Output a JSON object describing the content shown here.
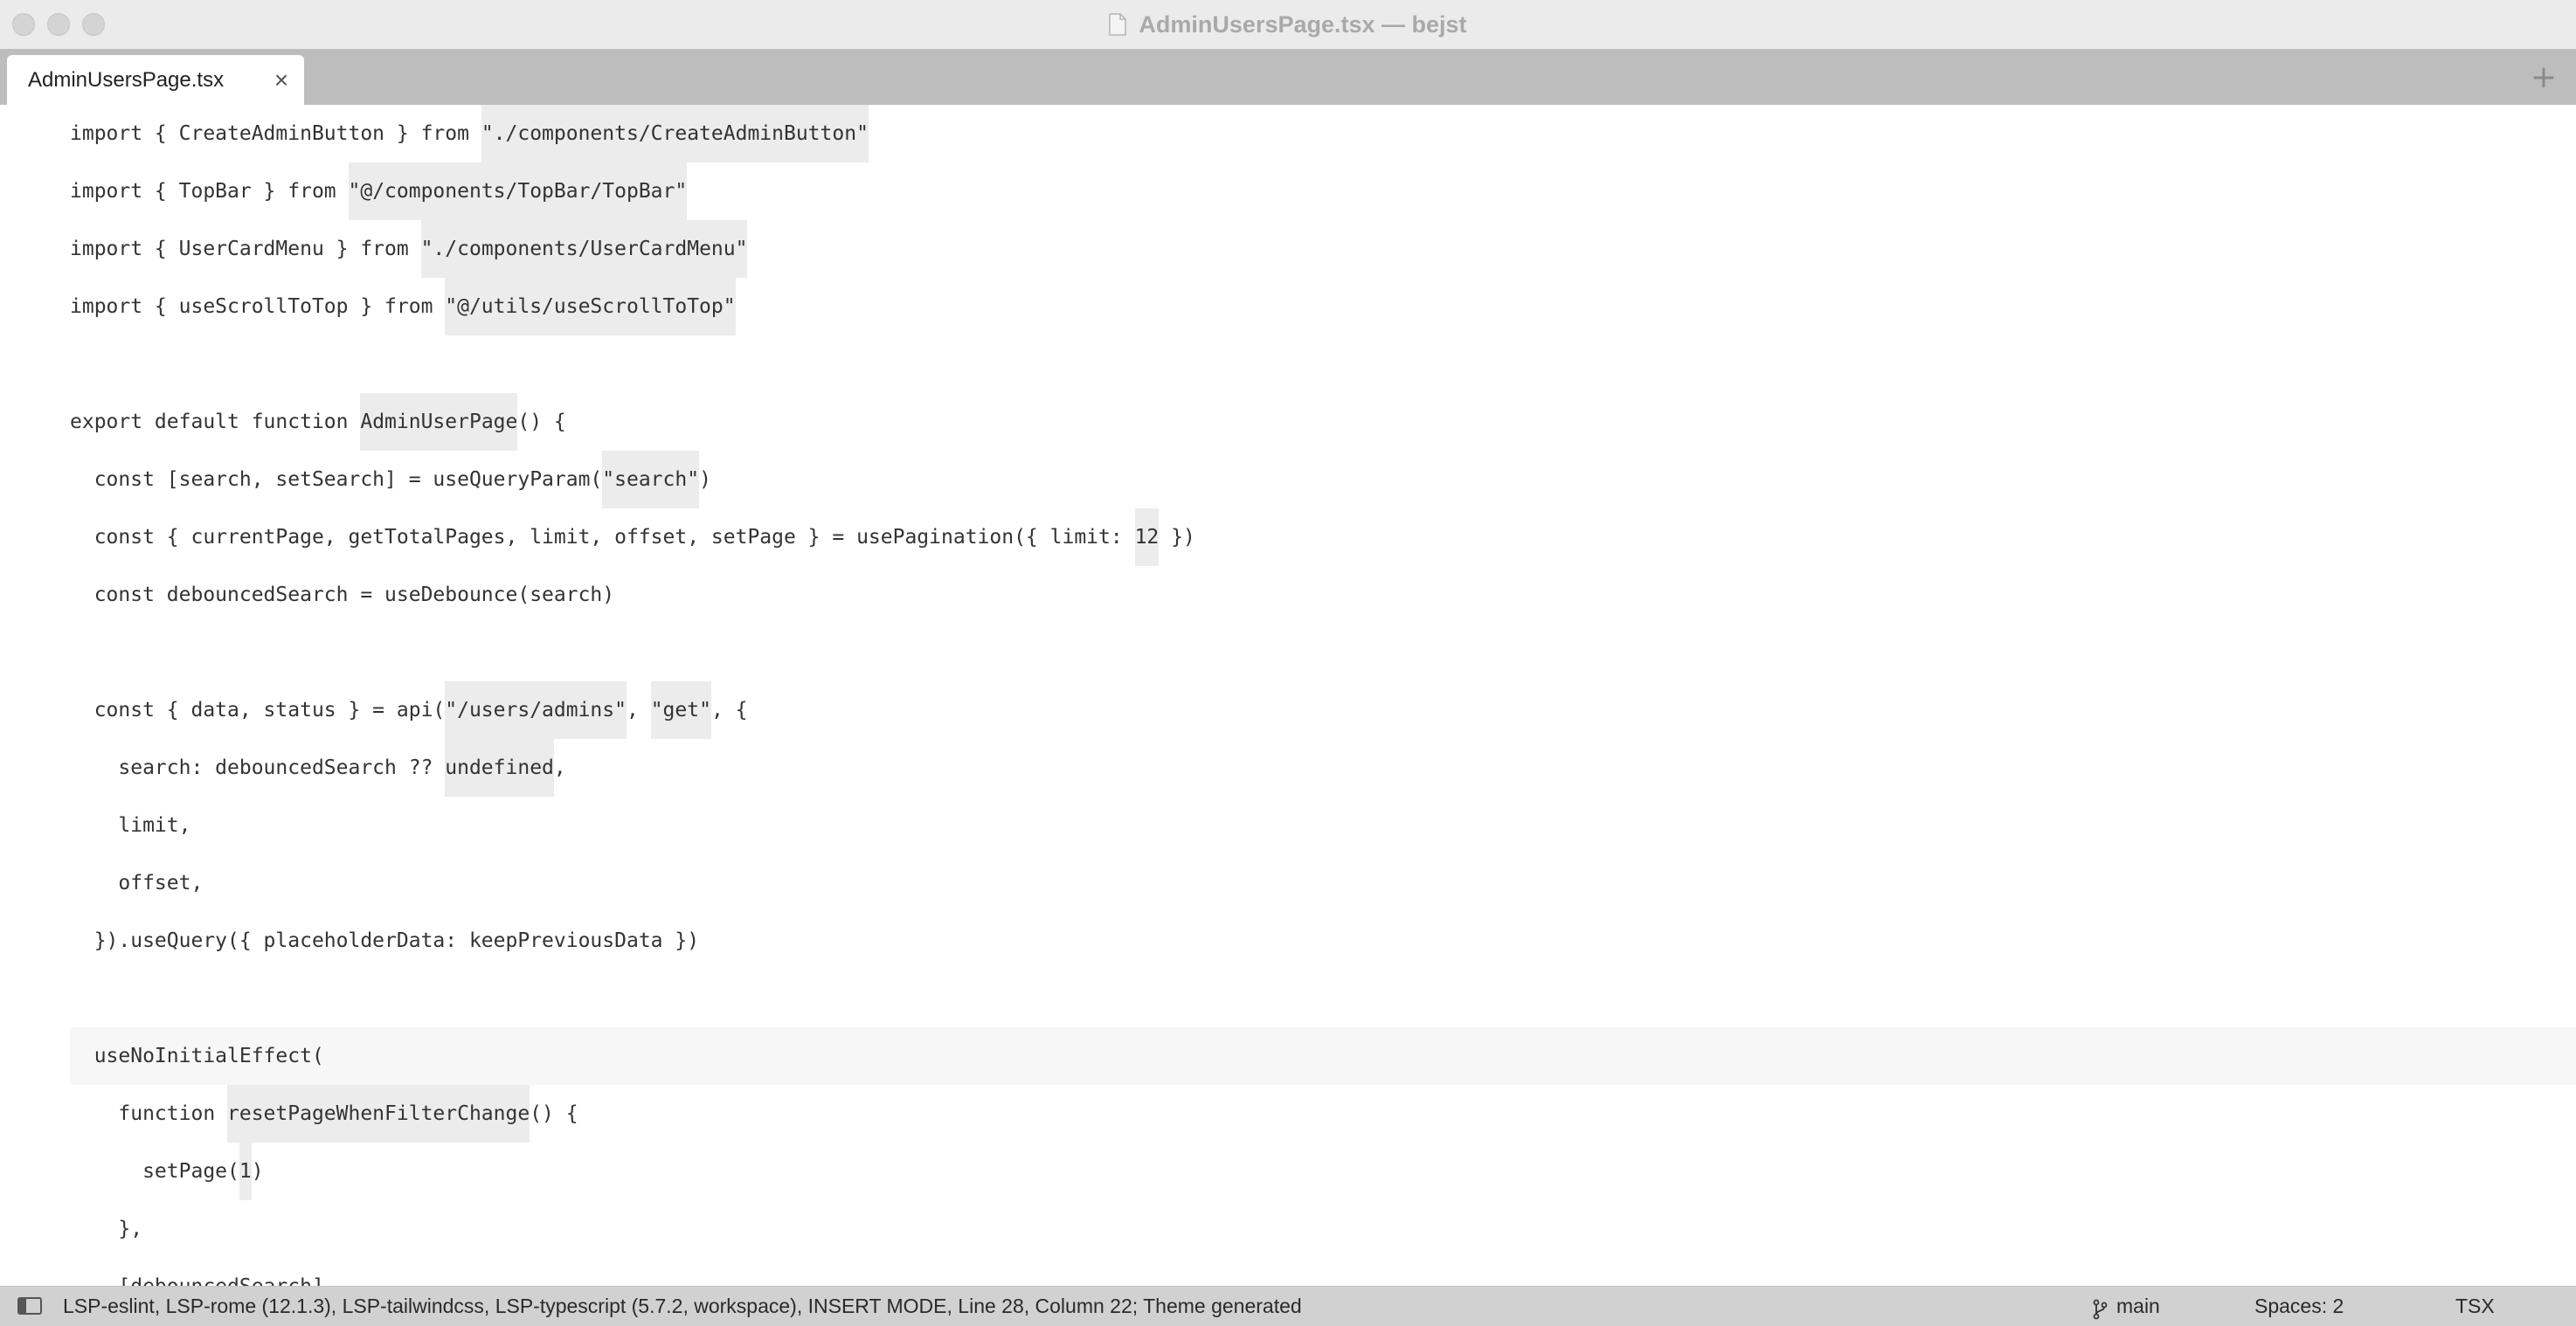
{
  "window": {
    "title": "AdminUsersPage.tsx — bejst"
  },
  "tabs": [
    {
      "label": "AdminUsersPage.tsx",
      "close": "×",
      "active": true
    }
  ],
  "tabbar": {
    "add_label": "+"
  },
  "editor": {
    "current_line_index": 16,
    "lines": [
      {
        "segments": [
          {
            "t": "import { CreateAdminButton } from "
          },
          {
            "t": "\"./components/CreateAdminButton\"",
            "hl": true
          }
        ]
      },
      {
        "segments": [
          {
            "t": "import { TopBar } from "
          },
          {
            "t": "\"@/components/TopBar/TopBar\"",
            "hl": true
          }
        ]
      },
      {
        "segments": [
          {
            "t": "import { UserCardMenu } from "
          },
          {
            "t": "\"./components/UserCardMenu\"",
            "hl": true
          }
        ]
      },
      {
        "segments": [
          {
            "t": "import { useScrollToTop } from "
          },
          {
            "t": "\"@/utils/useScrollToTop\"",
            "hl": true
          }
        ]
      },
      {
        "segments": []
      },
      {
        "segments": [
          {
            "t": "export default function "
          },
          {
            "t": "AdminUserPage",
            "hl": true
          },
          {
            "t": "() {"
          }
        ]
      },
      {
        "segments": [
          {
            "t": "  const [search, setSearch] = useQueryParam("
          },
          {
            "t": "\"search\"",
            "hl": true
          },
          {
            "t": ")"
          }
        ]
      },
      {
        "segments": [
          {
            "t": "  const { currentPage, getTotalPages, limit, offset, setPage } = usePagination({ limit: "
          },
          {
            "t": "12",
            "hl": true
          },
          {
            "t": " })"
          }
        ]
      },
      {
        "segments": [
          {
            "t": "  const debouncedSearch = useDebounce(search)"
          }
        ]
      },
      {
        "segments": []
      },
      {
        "segments": [
          {
            "t": "  const { data, status } = api("
          },
          {
            "t": "\"/users/admins\"",
            "hl": true
          },
          {
            "t": ", "
          },
          {
            "t": "\"get\"",
            "hl": true
          },
          {
            "t": ", {"
          }
        ]
      },
      {
        "segments": [
          {
            "t": "    search: debouncedSearch ?? "
          },
          {
            "t": "undefined",
            "hl": true
          },
          {
            "t": ","
          }
        ]
      },
      {
        "segments": [
          {
            "t": "    limit,"
          }
        ]
      },
      {
        "segments": [
          {
            "t": "    offset,"
          }
        ]
      },
      {
        "segments": [
          {
            "t": "  }).useQuery({ placeholderData: keepPreviousData })"
          }
        ]
      },
      {
        "segments": []
      },
      {
        "segments": [
          {
            "t": "  useNoInitialEffect("
          }
        ]
      },
      {
        "segments": [
          {
            "t": "    function "
          },
          {
            "t": "resetPageWhenFilterChange",
            "hl": true
          },
          {
            "t": "() {"
          }
        ]
      },
      {
        "segments": [
          {
            "t": "      setPage("
          },
          {
            "t": "1",
            "hl": true
          },
          {
            "t": ")"
          }
        ]
      },
      {
        "segments": [
          {
            "t": "    },"
          }
        ]
      },
      {
        "segments": [
          {
            "t": "    [debouncedSearch],"
          }
        ]
      }
    ]
  },
  "statusbar": {
    "text": "LSP-eslint, LSP-rome (12.1.3), LSP-tailwindcss, LSP-typescript (5.7.2, workspace), INSERT MODE, Line 28, Column 22; Theme generated",
    "branch": "main",
    "spaces": "Spaces: 2",
    "syntax": "TSX"
  }
}
